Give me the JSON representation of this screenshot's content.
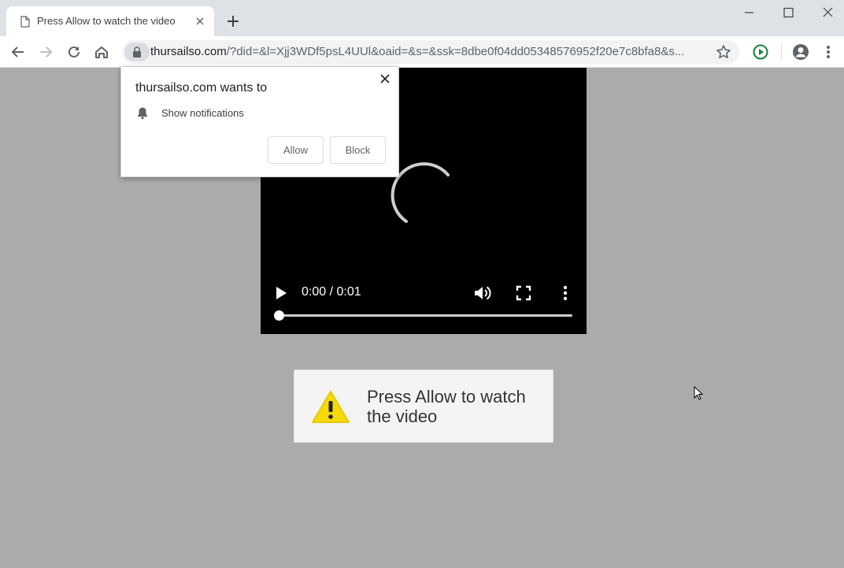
{
  "browser": {
    "tab": {
      "title": "Press Allow to watch the video"
    },
    "address": {
      "host": "thursailso.com",
      "path": "/?did=&l=Xjj3WDf5psL4UUl&oaid=&s=&ssk=8dbe0f04dd05348576952f20e7c8bfa8&s..."
    }
  },
  "permission_popup": {
    "title": "thursailso.com wants to",
    "item": "Show notifications",
    "allow_label": "Allow",
    "block_label": "Block"
  },
  "video": {
    "timecode": "0:00 / 0:01",
    "progress": 0
  },
  "message": {
    "text": "Press Allow to watch the video"
  },
  "colors": {
    "page_background": "#ababab",
    "warning_yellow": "#f5d90a",
    "accent_green": "#188038"
  }
}
